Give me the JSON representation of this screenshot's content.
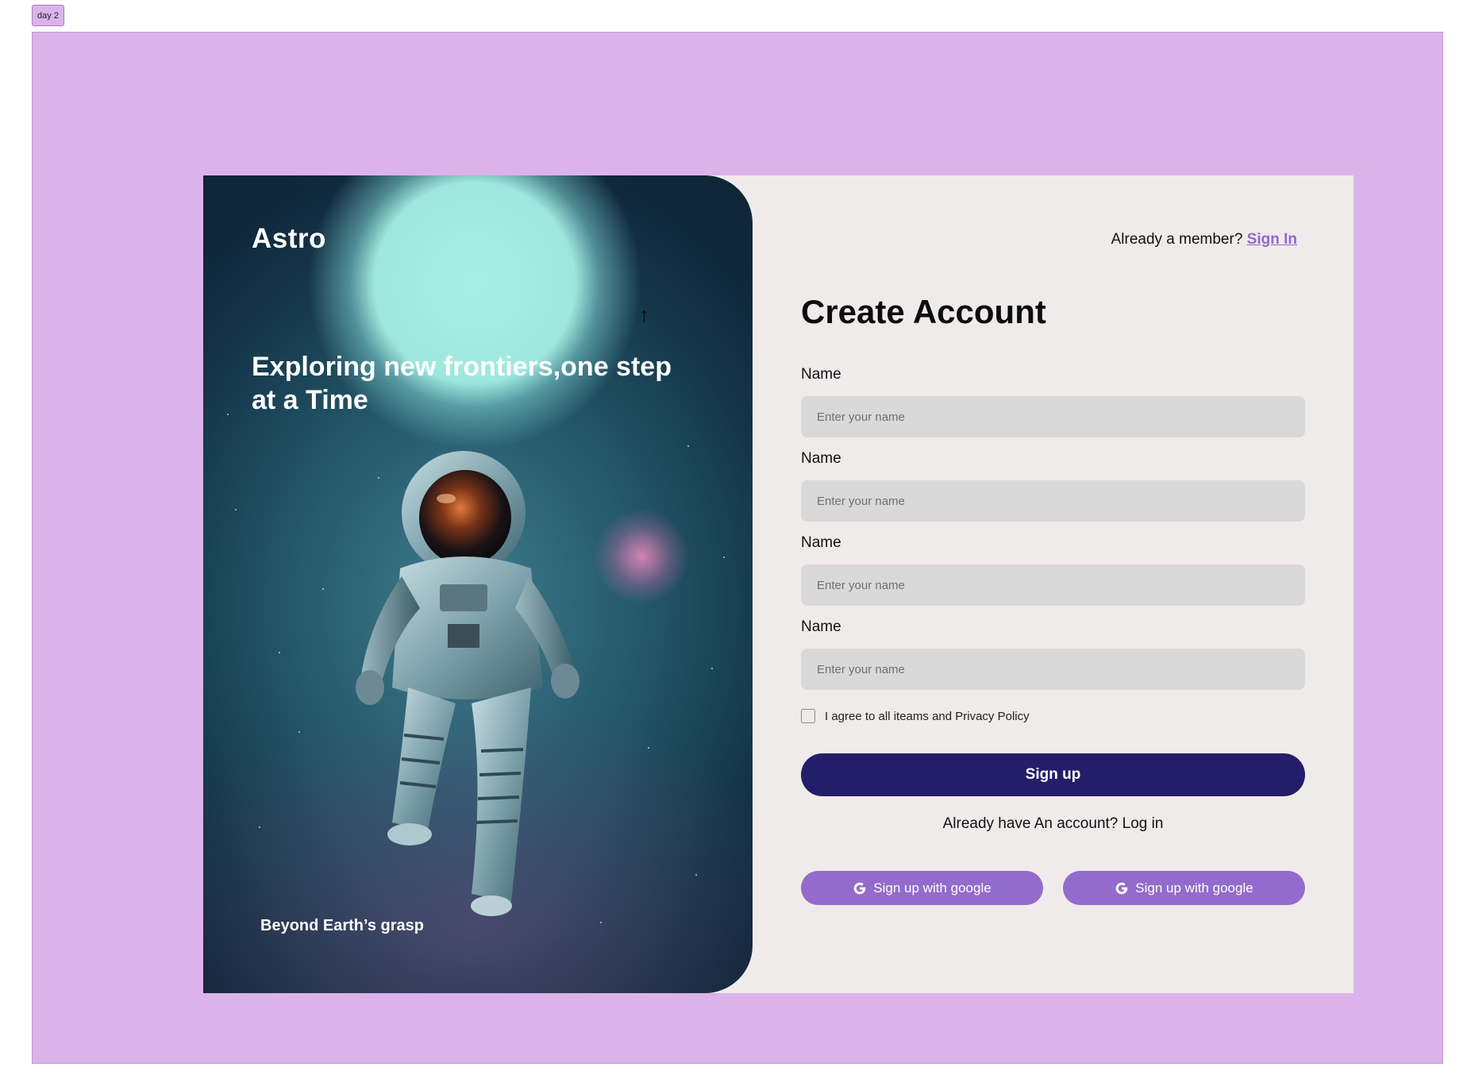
{
  "frame": {
    "tag": "day 2"
  },
  "hero": {
    "brand": "Astro",
    "tagline": "Exploring new frontiers,one step at a Time",
    "footer": "Beyond Earth’s grasp",
    "cursor_glyph": "↑"
  },
  "form": {
    "member_prompt": "Already a member?",
    "sign_in_link": "Sign In",
    "title": "Create Account",
    "fields": [
      {
        "label": "Name",
        "placeholder": "Enter your name",
        "value": ""
      },
      {
        "label": "Name",
        "placeholder": "Enter your name",
        "value": ""
      },
      {
        "label": "Name",
        "placeholder": "Enter your name",
        "value": ""
      },
      {
        "label": "Name",
        "placeholder": "Enter your name",
        "value": ""
      }
    ],
    "agree_text": "I agree to all iteams and Privacy Policy",
    "agree_checked": false,
    "signup_label": "Sign up",
    "login_prompt": "Already have An account? Log in",
    "google_buttons": [
      {
        "label": "Sign up with google",
        "icon": "google-g-icon"
      },
      {
        "label": "Sign up with google",
        "icon": "google-g-icon"
      }
    ]
  },
  "colors": {
    "frame_bg": "#dbb3ea",
    "card_bg": "#f0ebeb",
    "primary": "#221e6a",
    "accent": "#926bcc",
    "link": "#8d6acb",
    "input_bg": "#d9d9d9"
  }
}
